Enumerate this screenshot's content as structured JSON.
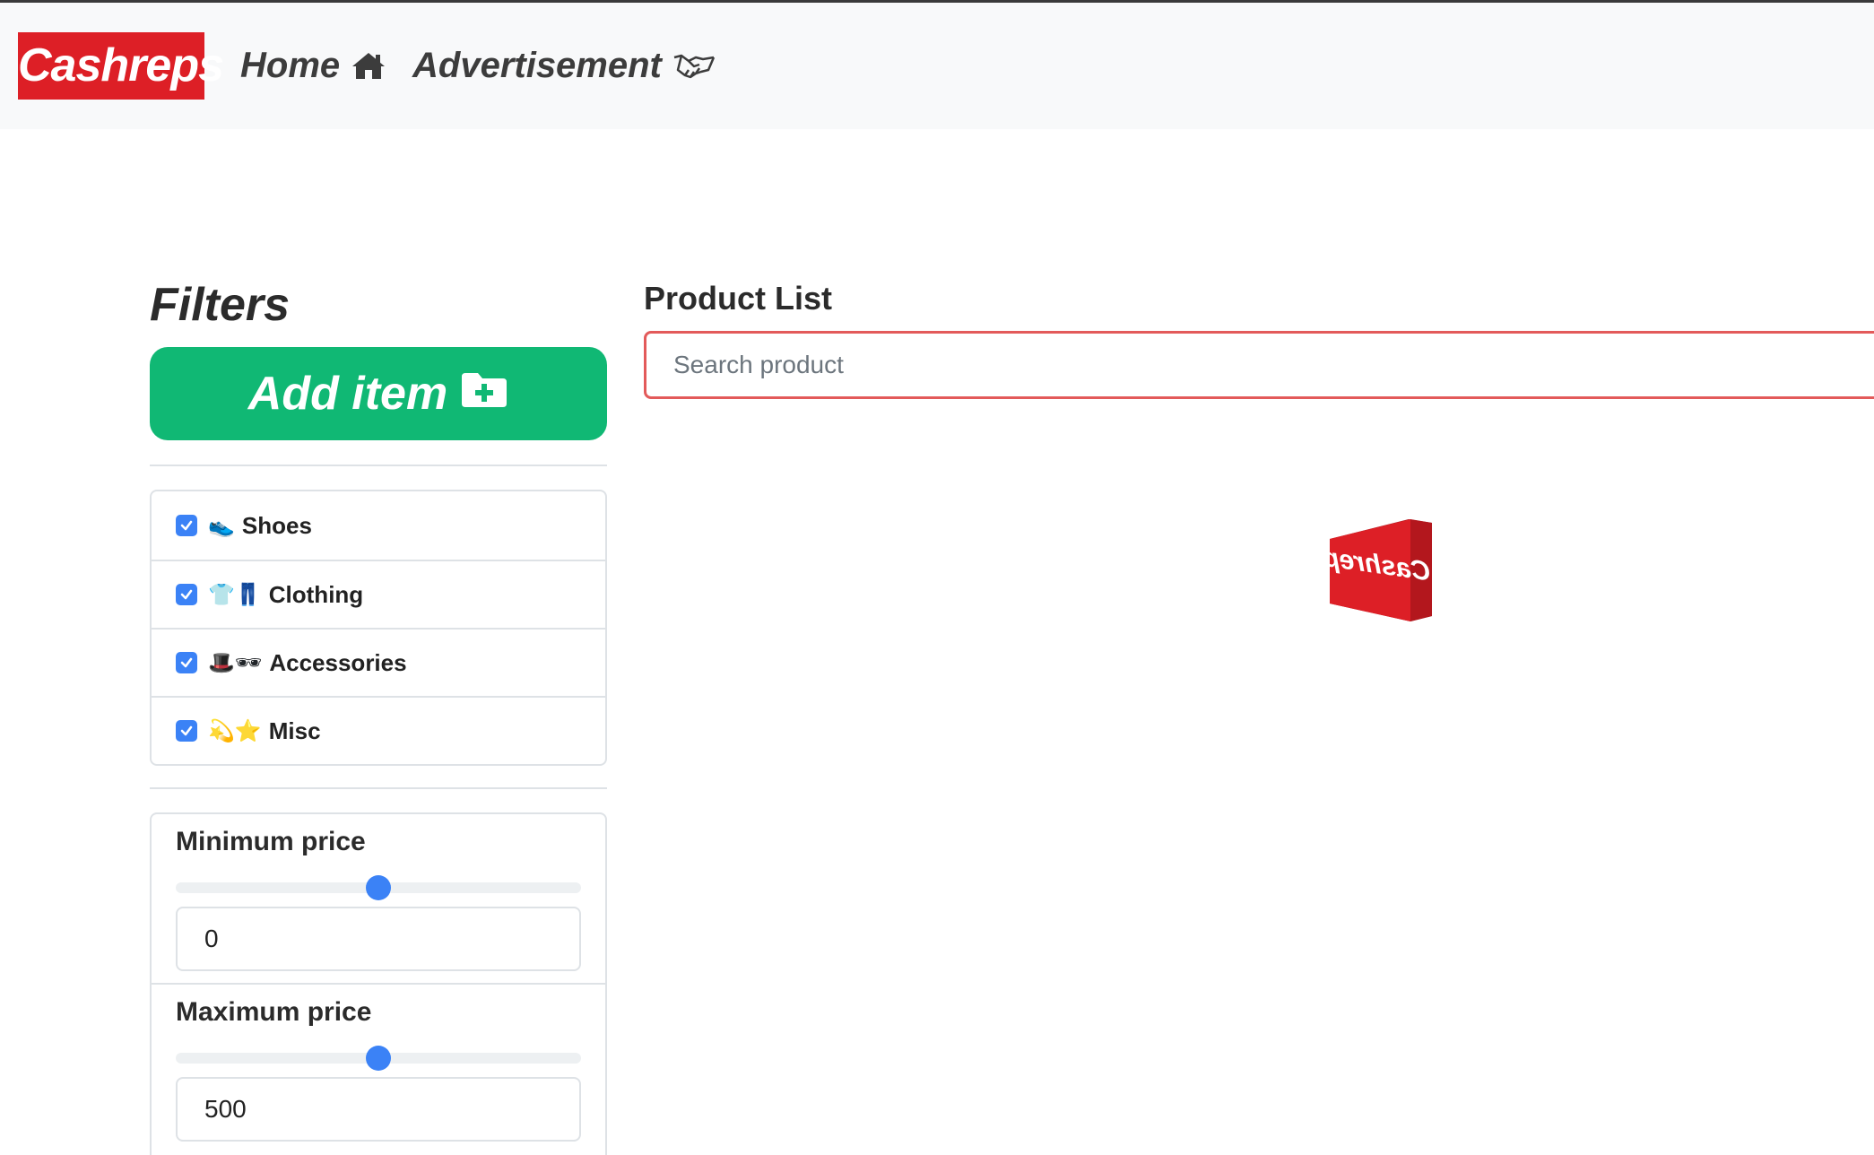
{
  "navbar": {
    "logo_text": "Cashreps",
    "home_label": "Home",
    "advertisement_label": "Advertisement",
    "icons": {
      "home": "home-icon",
      "advertisement": "handshake-icon"
    },
    "brand_color": "#dd1f26"
  },
  "sidebar": {
    "filters_title": "Filters",
    "add_item_label": "Add item",
    "add_item_icon": "folder-plus-icon",
    "add_item_color": "#10b874",
    "categories": [
      {
        "label": "Shoes",
        "emoji": "👟",
        "checked": true
      },
      {
        "label": "Clothing",
        "emoji": "👕👖",
        "checked": true
      },
      {
        "label": "Accessories",
        "emoji": "🎩🕶",
        "checked": true
      },
      {
        "label": "Misc",
        "emoji": "💫⭐",
        "checked": true
      }
    ],
    "min_price": {
      "label": "Minimum price",
      "value": "0",
      "slider_fraction": 0.5
    },
    "max_price": {
      "label": "Maximum price",
      "value": "500",
      "slider_fraction": 0.5
    }
  },
  "main": {
    "title": "Product List",
    "search_placeholder": "Search product",
    "loading_logo_text": "Cashreps",
    "search_border_color": "#e35a5a"
  }
}
